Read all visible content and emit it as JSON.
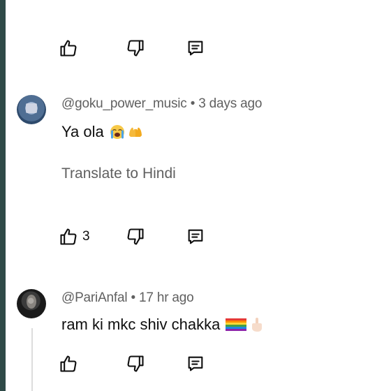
{
  "top_actions": {
    "like_count": ""
  },
  "comments": [
    {
      "author": "@goku_power_music",
      "separator": "•",
      "time": "3 days ago",
      "text": "Ya ola",
      "emojis": [
        "loudly-crying-face",
        "raised-hands"
      ],
      "translate_label": "Translate to Hindi",
      "like_count": "3"
    },
    {
      "author": "@PariAnfal",
      "separator": "•",
      "time": "17 hr ago",
      "text": "ram ki mkc shiv chakka",
      "emojis": [
        "rainbow-flag",
        "middle-finger"
      ],
      "like_count": ""
    }
  ],
  "icons": {
    "like": "thumbs-up-icon",
    "dislike": "thumbs-down-icon",
    "reply": "reply-comment-icon"
  },
  "colors": {
    "meta_text": "#606060",
    "body_text": "#0f0f0f",
    "edge": "#2f4a48"
  }
}
